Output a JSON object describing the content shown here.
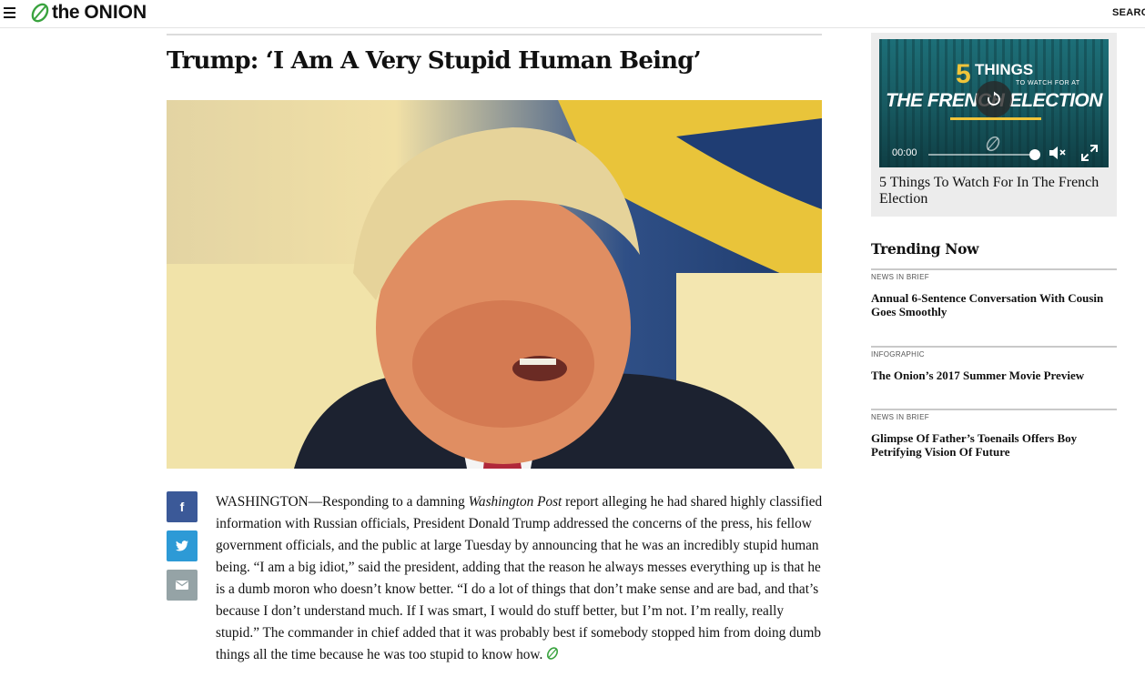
{
  "header": {
    "logo_text_prefix": "the",
    "logo_text_brand": "ONION",
    "search_label": "SEARCH"
  },
  "article": {
    "headline": "Trump: ‘I Am A Very Stupid Human Being’",
    "body_dateline": "WASHINGTON—Responding to a damning ",
    "body_em": "Washington Post",
    "body_rest": " report alleging he had shared highly classified information with Russian officials, President Donald Trump addressed the concerns of the press, his fellow government officials, and the public at large Tuesday by announcing that he was an incredibly stupid human being. “I am a big idiot,” said the president, adding that the reason he always messes everything up is that he is a dumb moron who doesn’t know better. “I do a lot of things that don’t make sense and are bad, and that’s because I don’t understand much. If I was smart, I would do stuff better, but I’m not. I’m really, really stupid.” The commander in chief added that it was probably best if somebody stopped him from doing dumb things all the time because he was too stupid to know how.",
    "share": {
      "facebook_glyph": "f",
      "twitter_glyph": "🐦",
      "email_glyph": "✉"
    }
  },
  "sidebar": {
    "video": {
      "overlay_number": "5",
      "overlay_things": "THINGS",
      "overlay_small": "TO WATCH FOR AT",
      "overlay_title": "THE FRENCH ELECTION",
      "time": "00:00",
      "progress": 1.0,
      "muted": true,
      "caption": "5 Things To Watch For In The French Election"
    },
    "trending": {
      "title": "Trending Now",
      "items": [
        {
          "kicker": "NEWS IN BRIEF",
          "headline": "Annual 6-Sentence Conversation With Cousin Goes Smoothly"
        },
        {
          "kicker": "INFOGRAPHIC",
          "headline": "The Onion’s 2017 Summer Movie Preview"
        },
        {
          "kicker": "NEWS IN BRIEF",
          "headline": "Glimpse Of Father’s Toenails Offers Boy Petrifying Vision Of Future"
        }
      ]
    }
  },
  "colors": {
    "brand_green": "#3aa33f",
    "facebook": "#3b5998",
    "twitter": "#2d9ad6",
    "email": "#95a3a6",
    "video_teal": "#1d6f78",
    "video_gold": "#f0c43a"
  },
  "icons": [
    "menu-icon",
    "onion-leaf-logo",
    "replay-icon",
    "mute-icon",
    "fullscreen-icon",
    "facebook-icon",
    "twitter-icon",
    "email-icon",
    "onion-end-mark-icon"
  ]
}
